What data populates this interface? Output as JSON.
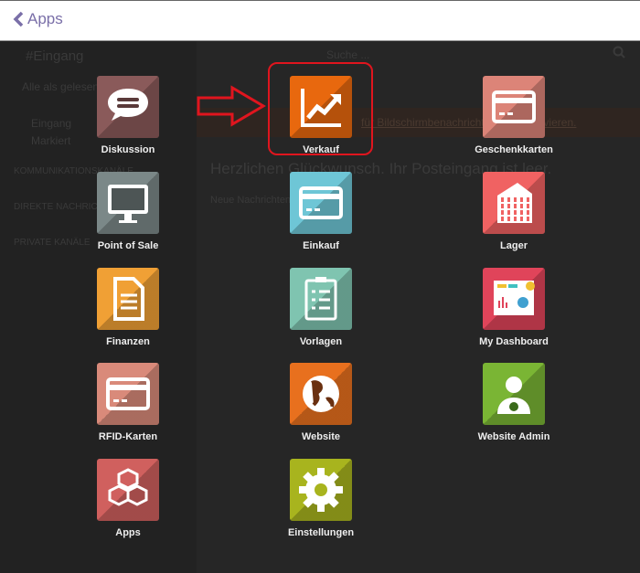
{
  "topbar": {
    "back_label": "Apps"
  },
  "background": {
    "channel_title": "#Eingang",
    "mark_read": "Alle als gelesen m",
    "inbox": "Eingang",
    "starred": "Markiert",
    "sec1": "KOMMUNIKATIONSKANÄLE",
    "sec2": "DIREKTE NACHRICHTEN",
    "sec3": "PRIVATE KANÄLE",
    "search_placeholder": "Suche ...",
    "notification": "für Bildschirmbenachrichtigungen aktivieren.",
    "empty": "Herzlichen Glückwunsch. Ihr Posteingang ist leer.",
    "new_messages": "Neue Nachrichten"
  },
  "apps": [
    {
      "label": "Diskussion",
      "color": "#8a5a5a",
      "icon": "chat-bubble-icon"
    },
    {
      "label": "Verkauf",
      "color": "#e8680e",
      "icon": "trend-chart-icon"
    },
    {
      "label": "Geschenkkarten",
      "color": "#dc8478",
      "icon": "credit-card-icon"
    },
    {
      "label": "Point of Sale",
      "color": "#7b8888",
      "icon": "monitor-icon"
    },
    {
      "label": "Einkauf",
      "color": "#6ec6d6",
      "icon": "credit-card-icon"
    },
    {
      "label": "Lager",
      "color": "#f06262",
      "icon": "building-icon"
    },
    {
      "label": "Finanzen",
      "color": "#f0a035",
      "icon": "document-icon"
    },
    {
      "label": "Vorlagen",
      "color": "#7fc4b0",
      "icon": "clipboard-icon"
    },
    {
      "label": "My Dashboard",
      "color": "#e0445a",
      "icon": "dashboard-icon"
    },
    {
      "label": "RFID-Karten",
      "color": "#d98a7a",
      "icon": "credit-card-icon"
    },
    {
      "label": "Website",
      "color": "#e8701e",
      "icon": "globe-icon"
    },
    {
      "label": "Website Admin",
      "color": "#7ab534",
      "icon": "user-gear-icon"
    },
    {
      "label": "Apps",
      "color": "#d0605e",
      "icon": "cubes-icon"
    },
    {
      "label": "Einstellungen",
      "color": "#a8b41e",
      "icon": "gear-icon"
    }
  ],
  "highlight_color": "#e0151e"
}
